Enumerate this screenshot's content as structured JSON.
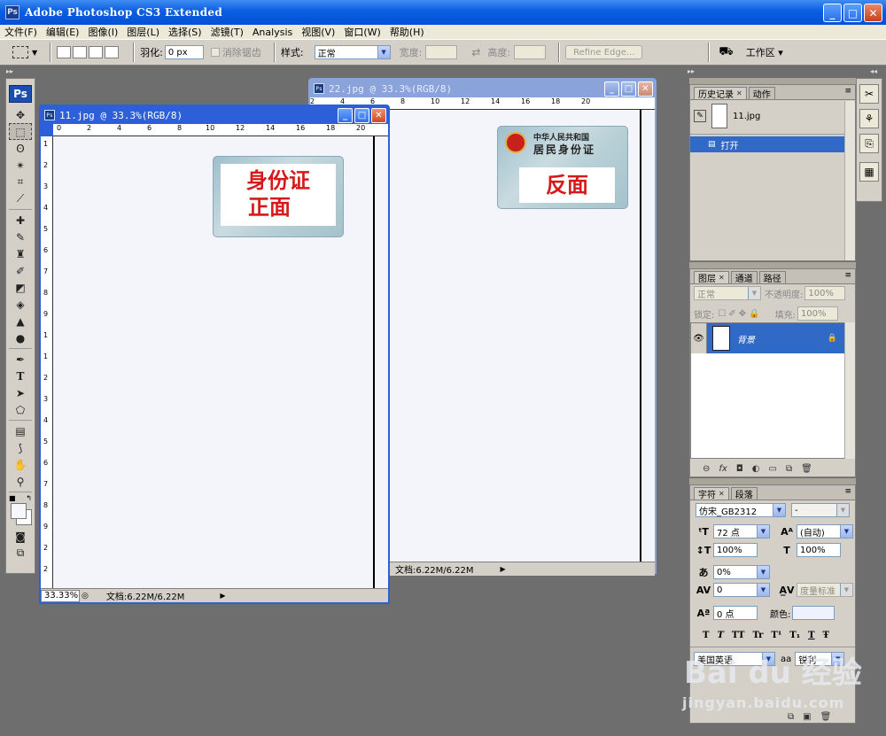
{
  "app": {
    "icon": "Ps",
    "title": "Adobe Photoshop CS3 Extended",
    "window_buttons": {
      "minimize": "_",
      "maximize": "□",
      "close": "✕"
    }
  },
  "menu": [
    "文件(F)",
    "编辑(E)",
    "图像(I)",
    "图层(L)",
    "选择(S)",
    "滤镜(T)",
    "Analysis",
    "视图(V)",
    "窗口(W)",
    "帮助(H)"
  ],
  "options": {
    "feather_label": "羽化:",
    "feather_value": "0 px",
    "antialias_label": "消除锯齿",
    "style_label": "样式:",
    "style_value": "正常",
    "width_label": "宽度:",
    "height_label": "高度:",
    "swap_glyph": "⇄",
    "refine_edge": "Refine Edge...",
    "workspace": "工作区 ▾"
  },
  "toolbox": {
    "logo": "Ps"
  },
  "documents": {
    "doc11": {
      "title": "11.jpg @ 33.3%(RGB/8)",
      "zoom": "33.33%",
      "doc_info": "文档:6.22M/6.22M",
      "card_label_line1": "身份证",
      "card_label_line2": "正面",
      "ruler_top": [
        "0",
        "2",
        "4",
        "6",
        "8",
        "10",
        "12",
        "14",
        "16",
        "18",
        "20"
      ],
      "ruler_left": [
        "1",
        "2",
        "3",
        "4",
        "5",
        "6",
        "7",
        "8",
        "9",
        "1",
        "1",
        "2",
        "3",
        "4",
        "5",
        "6",
        "7",
        "8",
        "9",
        "2",
        "2"
      ]
    },
    "doc22": {
      "title": "22.jpg @ 33.3%(RGB/8)",
      "doc_info": "文档:6.22M/6.22M",
      "card_label": "反面",
      "card_header1": "中华人民共和国",
      "card_header2": "居民身份证",
      "ruler_top": [
        "2",
        "4",
        "6",
        "8",
        "10",
        "12",
        "14",
        "16",
        "18",
        "20"
      ]
    }
  },
  "history_panel": {
    "tabs": [
      "历史记录",
      "动作"
    ],
    "snapshot": "11.jpg",
    "step": "打开"
  },
  "layers_panel": {
    "tabs": [
      "图层",
      "通道",
      "路径"
    ],
    "blend_mode": "正常",
    "opacity_label": "不透明度:",
    "opacity_value": "100%",
    "lock_label": "锁定:",
    "fill_label": "填充:",
    "fill_value": "100%",
    "layer_name": "背景"
  },
  "character_panel": {
    "tabs": [
      "字符",
      "段落"
    ],
    "font_family": "仿宋_GB2312",
    "font_style": "-",
    "font_size": "72 点",
    "leading": "(自动)",
    "vscale": "100%",
    "hscale": "100%",
    "tracking_pct": "0%",
    "kerning": "0",
    "kerning_method": "度量标准",
    "baseline": "0 点",
    "color_label": "颜色:",
    "language": "美国英语",
    "aa_label": "aa",
    "antialias": "锐利",
    "style_buttons": [
      "T",
      "T",
      "TT",
      "Tr",
      "T¹",
      "T₁",
      "T",
      "Ŧ"
    ]
  },
  "watermark": {
    "brand": "Bai du 经验",
    "url": "jingyan.baidu.com"
  }
}
